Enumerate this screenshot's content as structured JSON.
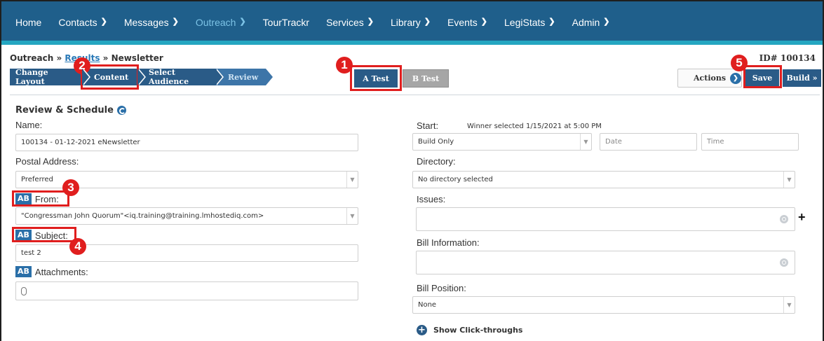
{
  "nav": {
    "items": [
      {
        "label": "Home",
        "chevron": ""
      },
      {
        "label": "Contacts",
        "chevron": "❯"
      },
      {
        "label": "Messages",
        "chevron": "❯"
      },
      {
        "label": "Outreach",
        "chevron": "❯"
      },
      {
        "label": "TourTrackr",
        "chevron": ""
      },
      {
        "label": "Services",
        "chevron": "❯"
      },
      {
        "label": "Library",
        "chevron": "❯"
      },
      {
        "label": "Events",
        "chevron": "❯"
      },
      {
        "label": "LegiStats",
        "chevron": "❯"
      },
      {
        "label": "Admin",
        "chevron": "❯"
      }
    ],
    "chev": "⌄",
    "active": "Outreach"
  },
  "breadcrumb": {
    "part1": "Outreach » ",
    "link": "Results",
    "part2": " » Newsletter"
  },
  "record_id": "ID# 100134",
  "steps": [
    "Change Layout",
    "Content",
    "Select Audience",
    "Review"
  ],
  "ab_tests": {
    "a": "A Test",
    "b": "B Test"
  },
  "toolbar": {
    "actions": "Actions",
    "save": "Save",
    "build": "Build »"
  },
  "section_title": "Review & Schedule",
  "form": {
    "name_label": "Name:",
    "name_value": "100134 - 01-12-2021 eNewsletter",
    "postal_label": "Postal Address:",
    "postal_value": "Preferred",
    "ab_tag": "AB",
    "from_label": "From:",
    "from_value": "\"Congressman John Quorum\"<iq.training@training.lmhostediq.com>",
    "subject_label": "Subject:",
    "subject_value": "test 2",
    "attachments_label": "Attachments:",
    "start_label": "Start:",
    "winner_note": "Winner selected 1/15/2021 at 5:00 PM",
    "start_value": "Build Only",
    "date_placeholder": "Date",
    "time_placeholder": "Time",
    "directory_label": "Directory:",
    "directory_value": "No directory selected",
    "issues_label": "Issues:",
    "bill_info_label": "Bill Information:",
    "bill_position_label": "Bill Position:",
    "bill_position_value": "None",
    "add_symbol": "+",
    "click_through": "Show Click-throughs"
  },
  "annotations": [
    "1",
    "2",
    "3",
    "4",
    "5"
  ],
  "colors": {
    "nav_bg": "#1f5f8b",
    "accent": "#2a5b87",
    "highlight": "#e01e1e",
    "teal": "#25a6c1"
  }
}
